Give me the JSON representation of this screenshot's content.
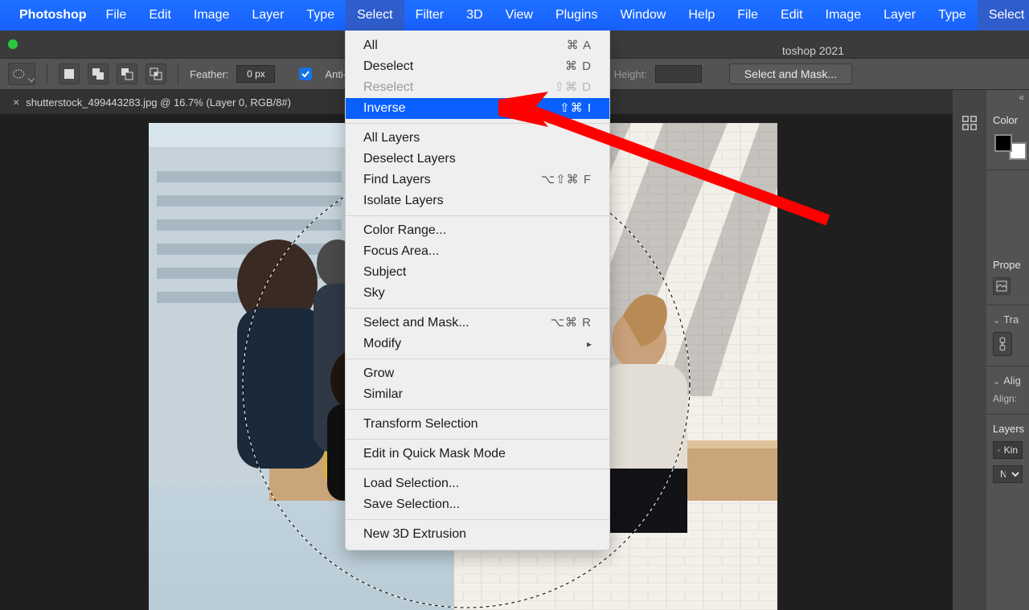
{
  "menubar": {
    "app_name": "Photoshop",
    "items": [
      "File",
      "Edit",
      "Image",
      "Layer",
      "Type",
      "Select",
      "Filter",
      "3D",
      "View",
      "Plugins",
      "Window",
      "Help"
    ],
    "active_index": 5
  },
  "titlebar": {
    "title_suffix": "toshop 2021"
  },
  "optionsbar": {
    "feather_label": "Feather:",
    "feather_value": "0 px",
    "anti_label": "Anti-",
    "height_label": "Height:",
    "select_mask_btn": "Select and Mask..."
  },
  "doc_tab": {
    "label": "shutterstock_499443283.jpg @ 16.7% (Layer 0, RGB/8#)"
  },
  "dropdown": {
    "groups": [
      [
        {
          "label": "All",
          "shortcut": "⌘ A",
          "enabled": true
        },
        {
          "label": "Deselect",
          "shortcut": "⌘ D",
          "enabled": true
        },
        {
          "label": "Reselect",
          "shortcut": "⇧⌘ D",
          "enabled": false
        },
        {
          "label": "Inverse",
          "shortcut": "⇧⌘ I",
          "enabled": true,
          "highlight": true
        }
      ],
      [
        {
          "label": "All Layers",
          "shortcut": "",
          "enabled": true
        },
        {
          "label": "Deselect Layers",
          "shortcut": "",
          "enabled": true
        },
        {
          "label": "Find Layers",
          "shortcut": "⌥⇧⌘ F",
          "enabled": true
        },
        {
          "label": "Isolate Layers",
          "shortcut": "",
          "enabled": true
        }
      ],
      [
        {
          "label": "Color Range...",
          "shortcut": "",
          "enabled": true
        },
        {
          "label": "Focus Area...",
          "shortcut": "",
          "enabled": true
        },
        {
          "label": "Subject",
          "shortcut": "",
          "enabled": true
        },
        {
          "label": "Sky",
          "shortcut": "",
          "enabled": true
        }
      ],
      [
        {
          "label": "Select and Mask...",
          "shortcut": "⌥⌘ R",
          "enabled": true
        },
        {
          "label": "Modify",
          "submenu": true,
          "enabled": true
        }
      ],
      [
        {
          "label": "Grow",
          "shortcut": "",
          "enabled": true
        },
        {
          "label": "Similar",
          "shortcut": "",
          "enabled": true
        }
      ],
      [
        {
          "label": "Transform Selection",
          "shortcut": "",
          "enabled": true
        }
      ],
      [
        {
          "label": "Edit in Quick Mask Mode",
          "shortcut": "",
          "enabled": true
        }
      ],
      [
        {
          "label": "Load Selection...",
          "shortcut": "",
          "enabled": true
        },
        {
          "label": "Save Selection...",
          "shortcut": "",
          "enabled": true
        }
      ],
      [
        {
          "label": "New 3D Extrusion",
          "shortcut": "",
          "enabled": true
        }
      ]
    ]
  },
  "panels": {
    "color_label": "Color",
    "properties_label": "Prope",
    "transform_label": "Tra",
    "align_label": "Alig",
    "align_sub": "Align:",
    "layers_label": "Layers",
    "kind_label": "Kin",
    "normal_label": "Norma"
  }
}
